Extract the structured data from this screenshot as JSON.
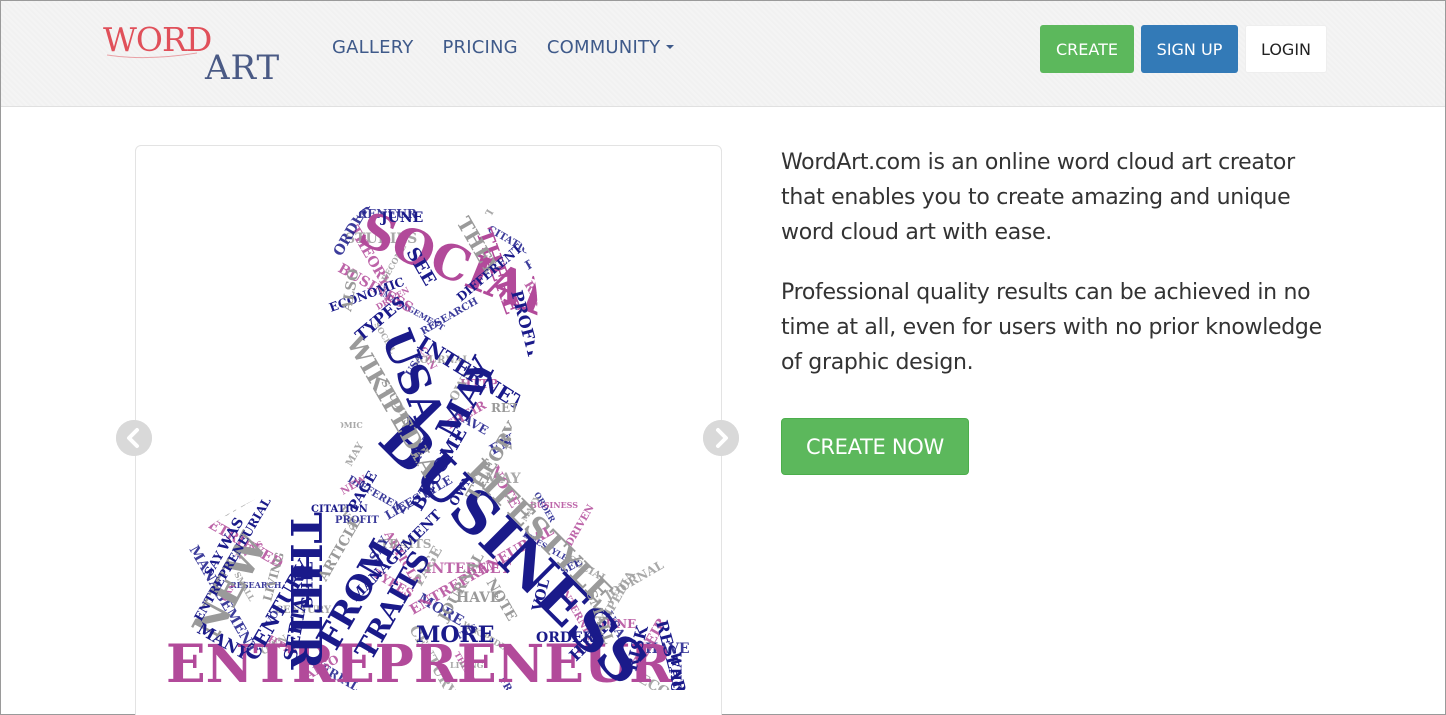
{
  "brand": {
    "logo_word": "WORD",
    "logo_art": "ART",
    "colors": {
      "red": "#e0505a",
      "navy": "#4a5a85"
    }
  },
  "nav": {
    "links": [
      {
        "label": "GALLERY"
      },
      {
        "label": "PRICING"
      },
      {
        "label": "COMMUNITY"
      }
    ],
    "actions": {
      "create_label": "CREATE",
      "signup_label": "SIGN UP",
      "login_label": "LOGIN"
    }
  },
  "carousel": {
    "prev_icon": "chevron-left-icon",
    "next_icon": "chevron-right-icon",
    "words": [
      "ENTREPRENEUR",
      "BUSINESS",
      "SOCIAL",
      "USA",
      "THEIR",
      "MAY",
      "LIFESTYLE",
      "INTERNET",
      "WIKIPEDIA",
      "FROM",
      "NEW",
      "TRAITS",
      "MORE",
      "THERE",
      "THEY",
      "PROFIT",
      "TYPES",
      "CENTURY",
      "SERIAL",
      "THEORY",
      "BECOME",
      "RESEARCH",
      "HTTP",
      "RISK",
      "ORDER",
      "DRIVEN",
      "JOURNAL",
      "HAVE",
      "NOTE",
      "MANY",
      "SEE",
      "JUNE",
      "ECONOMIC",
      "DIFFERENT",
      "ARTICLE",
      "PAGE",
      "THIS",
      "WHO",
      "WAS",
      "SAY",
      "ENTREPRENEURIAL",
      "LIVING",
      "CITATION",
      "RETRIEVED",
      "SMALL",
      "VOL",
      "ALSO",
      "STUDIES",
      "MANAGEMENT",
      "CAN",
      "OWN"
    ]
  },
  "intro": {
    "paragraph1": "WordArt.com is an online word cloud art creator that enables you to create amazing and unique word cloud art with ease.",
    "paragraph2": "Professional quality results can be achieved in no time at all, even for users with no prior knowledge of graphic design.",
    "cta_label": "CREATE NOW"
  },
  "colors": {
    "create_green": "#5cb85c",
    "signup_blue": "#337ab7",
    "nav_text": "#3f5a8a",
    "body_text": "#333333",
    "word_navy": "#1a1a8a",
    "word_pink": "#b24a9a",
    "word_gray": "#9a9a9a"
  }
}
